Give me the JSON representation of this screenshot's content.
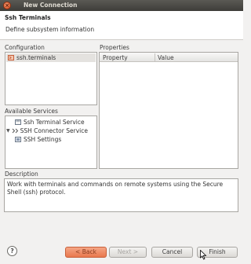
{
  "window": {
    "title": "New Connection"
  },
  "header": {
    "title": "Ssh Terminals",
    "subtitle": "Define subsystem information"
  },
  "configuration": {
    "label": "Configuration",
    "items": [
      "ssh.terminals"
    ]
  },
  "properties": {
    "label": "Properties",
    "columns": [
      "Property",
      "Value"
    ]
  },
  "services": {
    "label": "Available Services",
    "items": [
      "Ssh Terminal Service",
      "SSH Connector Service",
      "SSH Settings"
    ]
  },
  "description": {
    "label": "Description",
    "text": "Work with terminals and commands on remote systems using the Secure Shell (ssh) protocol."
  },
  "buttons": {
    "help": "?",
    "back": "< Back",
    "next": "Next >",
    "cancel": "Cancel",
    "finish": "Finish"
  }
}
